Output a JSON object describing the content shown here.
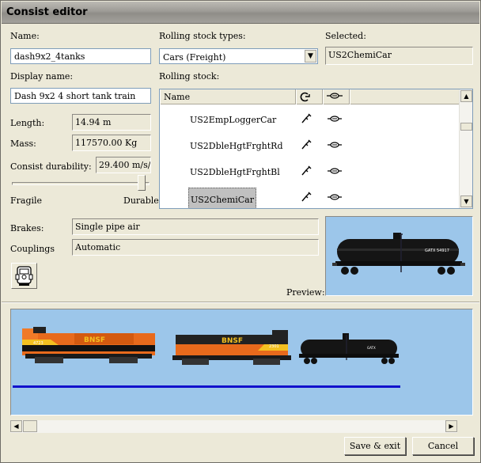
{
  "window": {
    "title": "Consist editor"
  },
  "name": {
    "label": "Name:",
    "value": "dash9x2_4tanks"
  },
  "display_name": {
    "label": "Display name:",
    "value": "Dash 9x2 4 short tank train"
  },
  "rolling_stock_types": {
    "label": "Rolling stock types:",
    "selected": "Cars (Freight)"
  },
  "selected": {
    "label": "Selected:",
    "value": "US2ChemiCar"
  },
  "rolling_stock": {
    "label": "Rolling stock:",
    "columns": [
      "Name",
      "",
      ""
    ],
    "items": [
      {
        "name": "US2EmpLoggerCar"
      },
      {
        "name": "US2DbleHgtFrghtRd"
      },
      {
        "name": "US2DbleHgtFrghtBl"
      },
      {
        "name": "US2ChemiCar",
        "selected": true
      }
    ]
  },
  "length": {
    "label": "Length:",
    "value": "14.94 m"
  },
  "mass": {
    "label": "Mass:",
    "value": "117570.00 Kg"
  },
  "durability": {
    "label": "Consist durability:",
    "value": "29.400 m/s/s",
    "min_label": "Fragile",
    "max_label": "Durable",
    "level": 0.95
  },
  "brakes": {
    "label": "Brakes:",
    "value": "Single pipe air"
  },
  "couplings": {
    "label": "Couplings",
    "value": "Automatic"
  },
  "preview": {
    "label": "Preview:",
    "car_text": "GATX 54917"
  },
  "consist_view": {
    "units": [
      {
        "kind": "locomotive",
        "road": "BNSF",
        "number": "4723"
      },
      {
        "kind": "locomotive",
        "road": "BNSF",
        "number": "2301"
      },
      {
        "kind": "tank-car",
        "number": "GATX"
      }
    ]
  },
  "buttons": {
    "save": "Save & exit",
    "cancel": "Cancel"
  },
  "colors": {
    "sky": "#9cc6ea",
    "track": "#1111cc",
    "bnsf_orange": "#e86a1c"
  }
}
